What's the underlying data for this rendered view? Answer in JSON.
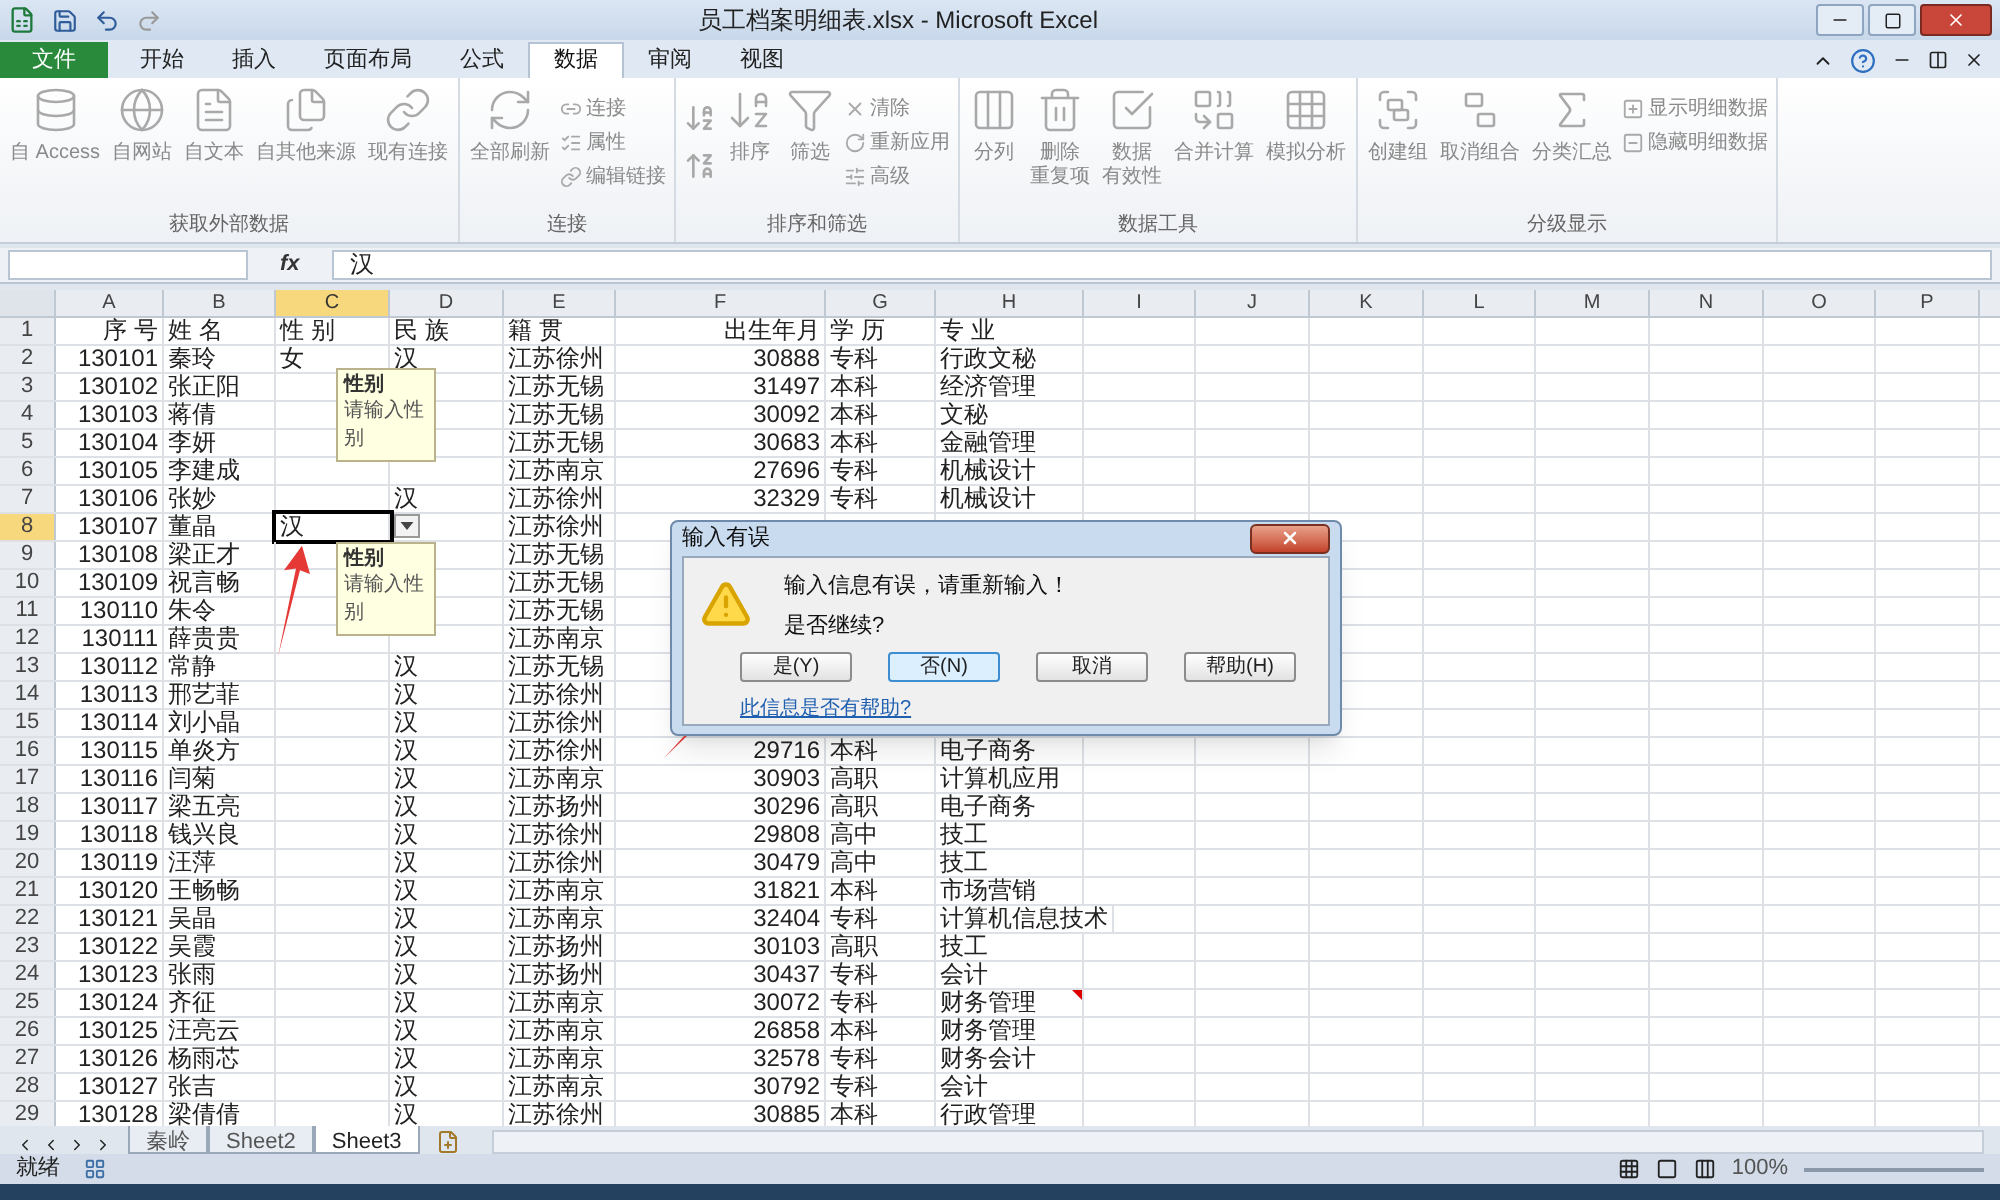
{
  "window": {
    "title": "员工档案明细表.xlsx - Microsoft Excel"
  },
  "tabs": [
    {
      "label": "文件",
      "kind": "file",
      "selected": false
    },
    {
      "label": "开始",
      "kind": "tab",
      "selected": false
    },
    {
      "label": "插入",
      "kind": "tab",
      "selected": false
    },
    {
      "label": "页面布局",
      "kind": "tab",
      "selected": false
    },
    {
      "label": "公式",
      "kind": "tab",
      "selected": false
    },
    {
      "label": "数据",
      "kind": "tab",
      "selected": true
    },
    {
      "label": "审阅",
      "kind": "tab",
      "selected": false
    },
    {
      "label": "视图",
      "kind": "tab",
      "selected": false
    }
  ],
  "ribbon": {
    "disabled": true,
    "groups": [
      {
        "label": "获取外部数据",
        "items": [
          {
            "label": "自 Access",
            "kind": "large"
          },
          {
            "label": "自网站",
            "kind": "large"
          },
          {
            "label": "自文本",
            "kind": "large"
          },
          {
            "label": "自其他来源",
            "kind": "large"
          },
          {
            "label": "现有连接",
            "kind": "large"
          }
        ]
      },
      {
        "label": "连接",
        "items": [
          {
            "label": "全部刷新",
            "kind": "large"
          },
          {
            "label": "连接",
            "kind": "small"
          },
          {
            "label": "属性",
            "kind": "small"
          },
          {
            "label": "编辑链接",
            "kind": "small"
          }
        ]
      },
      {
        "label": "排序和筛选",
        "items": [
          {
            "kind": "sorticons"
          },
          {
            "label": "排序",
            "kind": "large"
          },
          {
            "label": "筛选",
            "kind": "large"
          },
          {
            "label": "清除",
            "kind": "small"
          },
          {
            "label": "重新应用",
            "kind": "small"
          },
          {
            "label": "高级",
            "kind": "small"
          }
        ]
      },
      {
        "label": "数据工具",
        "items": [
          {
            "label": "分列",
            "kind": "large"
          },
          {
            "label": "删除",
            "label_2": "重复项",
            "kind": "large"
          },
          {
            "label": "数据",
            "label_2": "有效性",
            "kind": "large"
          },
          {
            "label": "合并计算",
            "kind": "large"
          },
          {
            "label": "模拟分析",
            "kind": "large"
          }
        ]
      },
      {
        "label": "分级显示",
        "items": [
          {
            "label": "创建组",
            "kind": "large"
          },
          {
            "label": "取消组合",
            "kind": "large"
          },
          {
            "label": "分类汇总",
            "kind": "large"
          },
          {
            "label": "显示明细数据",
            "kind": "small"
          },
          {
            "label": "隐藏明细数据",
            "kind": "small"
          }
        ]
      }
    ]
  },
  "formula_bar": {
    "function_label": "fx",
    "value": "汉"
  },
  "sheet": {
    "columns": [
      {
        "label": "A",
        "selected": false
      },
      {
        "label": "B",
        "selected": false
      },
      {
        "label": "C",
        "selected": true
      },
      {
        "label": "D",
        "selected": false
      },
      {
        "label": "E",
        "selected": false
      },
      {
        "label": "F",
        "selected": false
      },
      {
        "label": "G",
        "selected": false
      },
      {
        "label": "H",
        "selected": false
      },
      {
        "label": "I",
        "selected": false
      },
      {
        "label": "J",
        "selected": false
      },
      {
        "label": "K",
        "selected": false
      },
      {
        "label": "L",
        "selected": false
      },
      {
        "label": "M",
        "selected": false
      },
      {
        "label": "N",
        "selected": false
      },
      {
        "label": "O",
        "selected": false
      },
      {
        "label": "P",
        "selected": false
      }
    ],
    "rows": [
      {
        "num": "1",
        "selected": false,
        "comment": false,
        "seq": "序 号",
        "name": "姓 名",
        "gender": "性 别",
        "ethnicity": "民 族",
        "origin": "籍 贯",
        "birth": "出生年月",
        "education": "学 历",
        "major": "专 业"
      },
      {
        "num": "2",
        "selected": false,
        "comment": false,
        "seq": "130101",
        "name": "秦玲",
        "gender": "女",
        "ethnicity": "汉",
        "origin": "江苏徐州",
        "birth": "30888",
        "education": "专科",
        "major": "行政文秘"
      },
      {
        "num": "3",
        "selected": false,
        "comment": false,
        "seq": "130102",
        "name": "张正阳",
        "origin": "江苏无锡",
        "birth": "31497",
        "education": "本科",
        "major": "经济管理"
      },
      {
        "num": "4",
        "selected": false,
        "comment": false,
        "seq": "130103",
        "name": "蒋倩",
        "origin": "江苏无锡",
        "birth": "30092",
        "education": "本科",
        "major": "文秘"
      },
      {
        "num": "5",
        "selected": false,
        "comment": false,
        "seq": "130104",
        "name": "李妍",
        "origin": "江苏无锡",
        "birth": "30683",
        "education": "本科",
        "major": "金融管理"
      },
      {
        "num": "6",
        "selected": false,
        "comment": false,
        "seq": "130105",
        "name": "李建成",
        "origin": "江苏南京",
        "birth": "27696",
        "education": "专科",
        "major": "机械设计"
      },
      {
        "num": "7",
        "selected": false,
        "comment": false,
        "seq": "130106",
        "name": "张妙",
        "ethnicity": "汉",
        "origin": "江苏徐州",
        "birth": "32329",
        "education": "专科",
        "major": "机械设计"
      },
      {
        "num": "8",
        "selected": true,
        "comment": false,
        "seq": "130107",
        "name": "董晶",
        "gender": "汉",
        "origin": "江苏徐州"
      },
      {
        "num": "9",
        "selected": false,
        "comment": false,
        "seq": "130108",
        "name": "梁正才",
        "origin": "江苏无锡"
      },
      {
        "num": "10",
        "selected": false,
        "comment": false,
        "seq": "130109",
        "name": "祝言畅",
        "origin": "江苏无锡"
      },
      {
        "num": "11",
        "selected": false,
        "comment": false,
        "seq": "130110",
        "name": "朱令",
        "origin": "江苏无锡"
      },
      {
        "num": "12",
        "selected": false,
        "comment": false,
        "seq": "130111",
        "name": "薛贵贵",
        "origin": "江苏南京"
      },
      {
        "num": "13",
        "selected": false,
        "comment": false,
        "seq": "130112",
        "name": "常静",
        "ethnicity": "汉",
        "origin": "江苏无锡"
      },
      {
        "num": "14",
        "selected": false,
        "comment": false,
        "seq": "130113",
        "name": "邢艺菲",
        "ethnicity": "汉",
        "origin": "江苏徐州"
      },
      {
        "num": "15",
        "selected": false,
        "comment": false,
        "seq": "130114",
        "name": "刘小晶",
        "ethnicity": "汉",
        "origin": "江苏徐州"
      },
      {
        "num": "16",
        "selected": false,
        "comment": false,
        "seq": "130115",
        "name": "单炎方",
        "ethnicity": "汉",
        "origin": "江苏徐州",
        "birth": "29716",
        "education": "本科",
        "major": "电子商务"
      },
      {
        "num": "17",
        "selected": false,
        "comment": false,
        "seq": "130116",
        "name": "闫菊",
        "ethnicity": "汉",
        "origin": "江苏南京",
        "birth": "30903",
        "education": "高职",
        "major": "计算机应用"
      },
      {
        "num": "18",
        "selected": false,
        "comment": false,
        "seq": "130117",
        "name": "梁五亮",
        "ethnicity": "汉",
        "origin": "江苏扬州",
        "birth": "30296",
        "education": "高职",
        "major": "电子商务"
      },
      {
        "num": "19",
        "selected": false,
        "comment": false,
        "seq": "130118",
        "name": "钱兴良",
        "ethnicity": "汉",
        "origin": "江苏徐州",
        "birth": "29808",
        "education": "高中",
        "major": "技工"
      },
      {
        "num": "20",
        "selected": false,
        "comment": false,
        "seq": "130119",
        "name": "汪萍",
        "ethnicity": "汉",
        "origin": "江苏徐州",
        "birth": "30479",
        "education": "高中",
        "major": "技工"
      },
      {
        "num": "21",
        "selected": false,
        "comment": false,
        "seq": "130120",
        "name": "王畅畅",
        "ethnicity": "汉",
        "origin": "江苏南京",
        "birth": "31821",
        "education": "本科",
        "major": "市场营销"
      },
      {
        "num": "22",
        "selected": false,
        "comment": false,
        "seq": "130121",
        "name": "吴晶",
        "ethnicity": "汉",
        "origin": "江苏南京",
        "birth": "32404",
        "education": "专科",
        "major": "计算机信息技术"
      },
      {
        "num": "23",
        "selected": false,
        "comment": false,
        "seq": "130122",
        "name": "吴霞",
        "ethnicity": "汉",
        "origin": "江苏扬州",
        "birth": "30103",
        "education": "高职",
        "major": "技工"
      },
      {
        "num": "24",
        "selected": false,
        "comment": false,
        "seq": "130123",
        "name": "张雨",
        "ethnicity": "汉",
        "origin": "江苏扬州",
        "birth": "30437",
        "education": "专科",
        "major": "会计"
      },
      {
        "num": "25",
        "selected": false,
        "comment": true,
        "seq": "130124",
        "name": "齐征",
        "ethnicity": "汉",
        "origin": "江苏南京",
        "birth": "30072",
        "education": "专科",
        "major": "财务管理"
      },
      {
        "num": "26",
        "selected": false,
        "comment": false,
        "seq": "130125",
        "name": "汪亮云",
        "ethnicity": "汉",
        "origin": "江苏南京",
        "birth": "26858",
        "education": "本科",
        "major": "财务管理"
      },
      {
        "num": "27",
        "selected": false,
        "comment": false,
        "seq": "130126",
        "name": "杨雨芯",
        "ethnicity": "汉",
        "origin": "江苏南京",
        "birth": "32578",
        "education": "专科",
        "major": "财务会计"
      },
      {
        "num": "28",
        "selected": false,
        "comment": false,
        "seq": "130127",
        "name": "张吉",
        "ethnicity": "汉",
        "origin": "江苏南京",
        "birth": "30792",
        "education": "专科",
        "major": "会计"
      },
      {
        "num": "29",
        "selected": false,
        "comment": false,
        "seq": "130128",
        "name": "梁倩倩",
        "ethnicity": "汉",
        "origin": "江苏徐州",
        "birth": "30885",
        "education": "本科",
        "major": "行政管理"
      }
    ]
  },
  "tooltips": [
    {
      "title": "性别",
      "text": "请输入性别"
    },
    {
      "title": "性别",
      "text": "请输入性别"
    }
  ],
  "dialog": {
    "title": "输入有误",
    "message": "输入信息有误，请重新输入！",
    "question": "是否继续?",
    "buttons": [
      {
        "label": "是(Y)",
        "focused": false
      },
      {
        "label": "否(N)",
        "focused": true
      },
      {
        "label": "取消",
        "focused": false
      },
      {
        "label": "帮助(H)",
        "focused": false
      }
    ],
    "link": "此信息是否有帮助?"
  },
  "sheet_tabs": [
    {
      "label": "秦岭",
      "selected": false
    },
    {
      "label": "Sheet2",
      "selected": false
    },
    {
      "label": "Sheet3",
      "selected": true
    }
  ],
  "status_bar": {
    "text": "就绪",
    "zoom": "100%"
  }
}
